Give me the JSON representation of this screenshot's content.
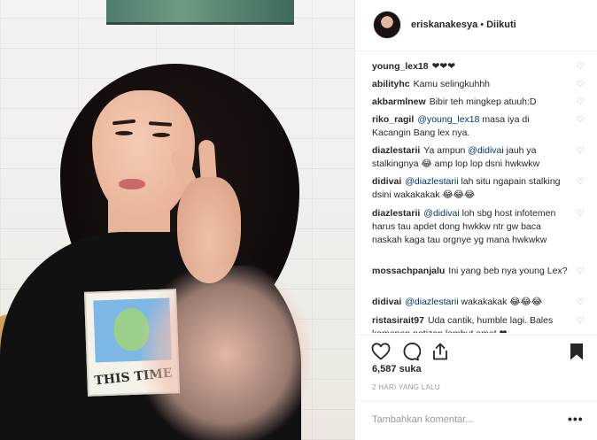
{
  "post": {
    "username": "eriskanakesya",
    "separator": "•",
    "follow_status": "Diikuti",
    "photo_print_text": "THIS TIME"
  },
  "comments": [
    {
      "author": "young_lex18",
      "parts": [
        {
          "t": "❤❤❤"
        }
      ]
    },
    {
      "author": "abilityhc",
      "parts": [
        {
          "t": "Kamu selingkuhhh"
        }
      ]
    },
    {
      "author": "akbarmlnew",
      "parts": [
        {
          "t": "Bibir teh mingkep atuuh:D"
        }
      ]
    },
    {
      "author": "riko_ragil",
      "parts": [
        {
          "m": "@young_lex18"
        },
        {
          "t": " masa iya di Kacangin Bang lex nya."
        }
      ]
    },
    {
      "author": "diazlestarii",
      "parts": [
        {
          "t": "Ya ampun "
        },
        {
          "m": "@didivai"
        },
        {
          "t": " jauh ya stalkingnya 😂 amp lop lop dsni hwkwkw"
        }
      ]
    },
    {
      "author": "didivai",
      "parts": [
        {
          "m": "@diazlestarii"
        },
        {
          "t": " lah situ ngapain stalking dsini wakakakak 😂😂😂"
        }
      ]
    },
    {
      "author": "diazlestarii",
      "parts": [
        {
          "m": "@didivai"
        },
        {
          "t": " loh sbg host infotemen harus tau apdet dong hwkkw ntr gw baca naskah kaga tau orgnye yg mana hwkwkw"
        }
      ]
    },
    {
      "author": "mossachpanjalu",
      "parts": [
        {
          "t": "Ini yang beb nya young Lex?"
        }
      ]
    },
    {
      "author": "didivai",
      "parts": [
        {
          "m": "@diazlestarii"
        },
        {
          "t": " wakakakak 😂😂😂"
        }
      ]
    },
    {
      "author": "ristasirait97",
      "parts": [
        {
          "t": "Uda cantik, humble lagi. Bales komenan netizen lembut amat ❤"
        }
      ]
    }
  ],
  "heart_icon": "♡",
  "actions": {
    "like_icon": "heart-outline-icon",
    "comment_icon": "comment-bubble-icon",
    "share_icon": "share-icon",
    "save_icon": "bookmark-icon"
  },
  "likes_text": "6,587 suka",
  "timestamp": "2 HARI YANG LALU",
  "add_comment": {
    "placeholder": "Tambahkan komentar...",
    "more_label": "•••"
  },
  "colors": {
    "text": "#262626",
    "mention": "#003569",
    "muted": "#999999",
    "border": "#efefef"
  }
}
